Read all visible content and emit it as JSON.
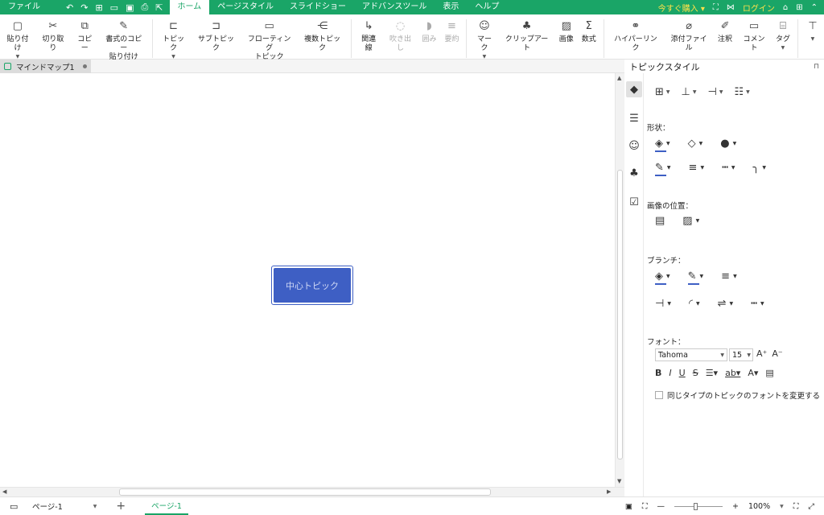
{
  "menubar": {
    "items": [
      "ファイル",
      "ホーム",
      "ページスタイル",
      "スライドショー",
      "アドバンスツール",
      "表示",
      "ヘルプ"
    ],
    "active": "ホーム",
    "buy_label": "今すぐ購入",
    "login_label": "ログイン"
  },
  "ribbon": {
    "paste": "貼り付け",
    "cut": "切り取り",
    "copy": "コピー",
    "format_paste": "書式のコピー\n貼り付け",
    "topic": "トピック",
    "subtopic": "サブトピック",
    "floating_topic": "フローティング\nトピック",
    "multi_topic": "複数トピック",
    "relation": "関連線",
    "callout": "吹き出し",
    "boundary": "囲み",
    "summary": "要約",
    "mark": "マーク",
    "clipart": "クリップアート",
    "image": "画像",
    "formula": "数式",
    "hyperlink": "ハイパーリンク",
    "attachment": "添付ファイル",
    "note": "注釈",
    "comment": "コメント",
    "tag": "タグ"
  },
  "document": {
    "tab_title": "マインドマップ1",
    "central_topic": "中心トピック"
  },
  "panel": {
    "title": "トピックスタイル",
    "shape_label": "形状：",
    "image_pos_label": "画像の位置：",
    "branch_label": "ブランチ：",
    "font_label": "フォント：",
    "font_family": "Tahoma",
    "font_size": "15",
    "same_type_label": "同じタイプのトピックのフォントを変更する",
    "accent_color": "#3e5fc4"
  },
  "statusbar": {
    "page_select": "ページ-1",
    "page_tab": "ページ-1",
    "zoom": "100%"
  },
  "colors": {
    "brand_green": "#1aa567",
    "topic_blue": "#3e5fc4"
  }
}
